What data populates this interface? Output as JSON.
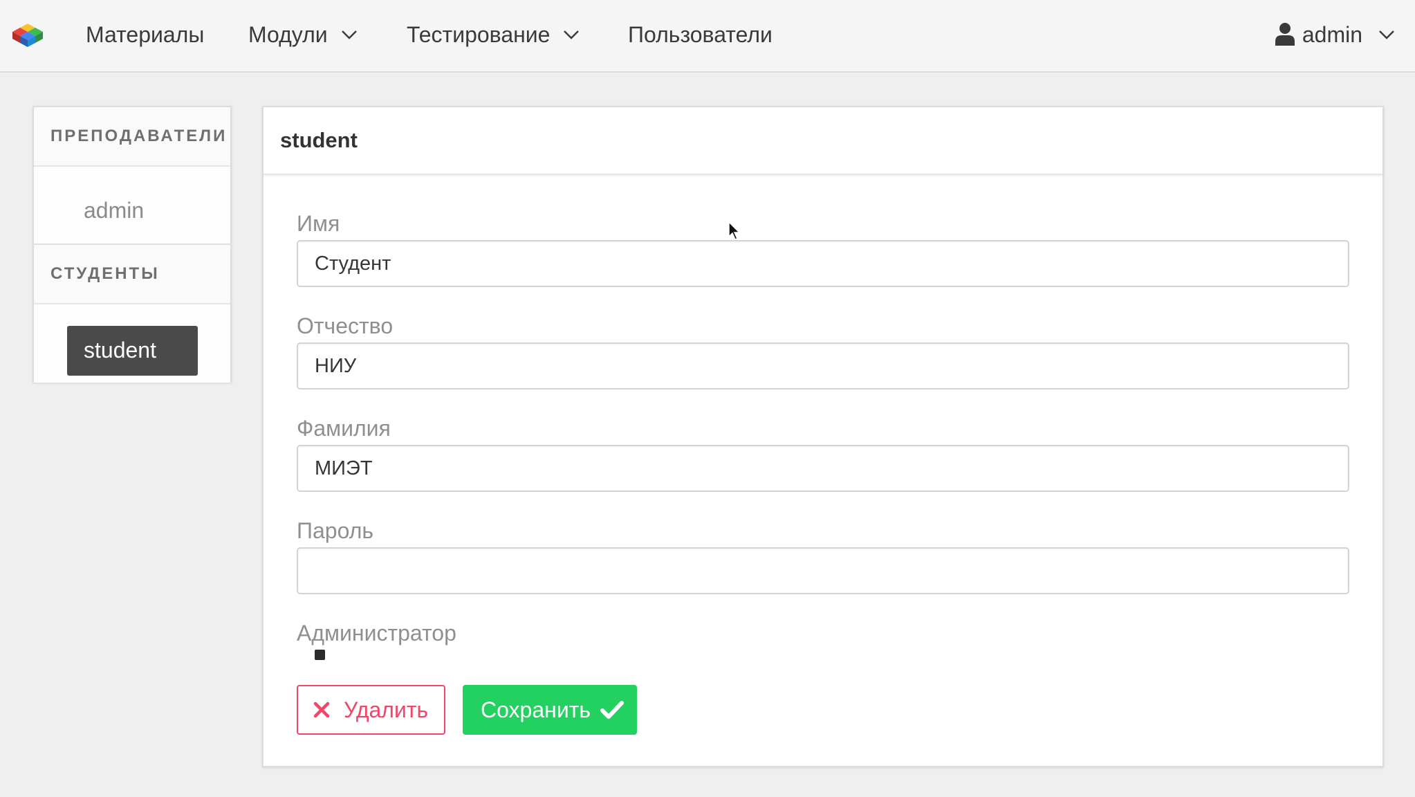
{
  "topbar": {
    "logo_icon": "colored-cubes-logo",
    "nav": [
      {
        "label": "Материалы",
        "has_dropdown": false
      },
      {
        "label": "Модули",
        "has_dropdown": true
      },
      {
        "label": "Тестирование",
        "has_dropdown": true
      },
      {
        "label": "Пользователи",
        "has_dropdown": false
      }
    ],
    "user": {
      "icon": "user-icon",
      "name": "admin",
      "has_dropdown": true
    }
  },
  "sidebar": {
    "teachers_heading": "ПРЕПОДАВАТЕЛИ",
    "teachers": [
      {
        "label": "admin",
        "active": false
      }
    ],
    "students_heading": "СТУДЕНТЫ",
    "students": [
      {
        "label": "student",
        "active": true
      }
    ]
  },
  "form": {
    "title": "student",
    "first_name": {
      "label": "Имя",
      "value": "Студент"
    },
    "patronymic": {
      "label": "Отчество",
      "value": "НИУ"
    },
    "last_name": {
      "label": "Фамилия",
      "value": "МИЭТ"
    },
    "password": {
      "label": "Пароль",
      "value": ""
    },
    "admin": {
      "label": "Администратор",
      "checked": false
    },
    "delete_label": "Удалить",
    "save_label": "Сохранить"
  },
  "colors": {
    "danger": "#f14668",
    "success": "#23d160",
    "active_item": "#4a4a4a",
    "topbar_bg": "#f5f5f5"
  }
}
